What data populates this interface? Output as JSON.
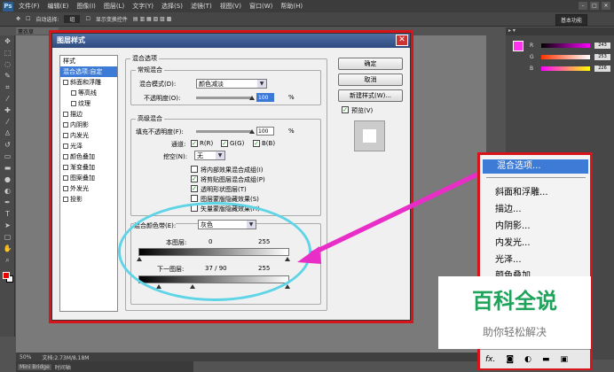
{
  "app": {
    "logo": "Ps",
    "menu": [
      "文件(F)",
      "编辑(E)",
      "图像(I)",
      "图层(L)",
      "文字(Y)",
      "选择(S)",
      "滤镜(T)",
      "视图(V)",
      "窗口(W)",
      "帮助(H)"
    ],
    "workspace": "基本功能"
  },
  "options": {
    "auto_select": "自动选择:",
    "auto_select_value": "组",
    "show_transform": "显示变换控件"
  },
  "doc_tab": "薰衣草",
  "status": {
    "zoom": "50%",
    "doc": "文档:2.73M/8.18M"
  },
  "bridge": {
    "tab1": "Mini Bridge",
    "tab2": "时间轴"
  },
  "color_panel": {
    "r": "243",
    "g": "253",
    "b": "226",
    "r_label": "R",
    "g_label": "G",
    "b_label": "B"
  },
  "dialog": {
    "title": "图层样式",
    "styles_header": "样式",
    "styles": [
      {
        "label": "混合选项:自定",
        "active": true,
        "checkbox": false,
        "indent": false
      },
      {
        "label": "斜面和浮雕",
        "checkbox": true,
        "indent": false
      },
      {
        "label": "等高线",
        "checkbox": true,
        "indent": true
      },
      {
        "label": "纹理",
        "checkbox": true,
        "indent": true
      },
      {
        "label": "描边",
        "checkbox": true,
        "indent": false
      },
      {
        "label": "内阴影",
        "checkbox": true,
        "indent": false
      },
      {
        "label": "内发光",
        "checkbox": true,
        "indent": false
      },
      {
        "label": "光泽",
        "checkbox": true,
        "indent": false
      },
      {
        "label": "颜色叠加",
        "checkbox": true,
        "indent": false
      },
      {
        "label": "渐变叠加",
        "checkbox": true,
        "indent": false
      },
      {
        "label": "图案叠加",
        "checkbox": true,
        "indent": false
      },
      {
        "label": "外发光",
        "checkbox": true,
        "indent": false
      },
      {
        "label": "投影",
        "checkbox": true,
        "indent": false
      }
    ],
    "blend_options": "混合选项",
    "general": "常规混合",
    "blend_mode_label": "混合模式(D):",
    "blend_mode_value": "颜色减淡",
    "opacity_label": "不透明度(O):",
    "opacity_value": "100",
    "percent": "%",
    "advanced": "高级混合",
    "fill_label": "填充不透明度(F):",
    "fill_value": "100",
    "channels_label": "通道:",
    "ch_r": "R(R)",
    "ch_g": "G(G)",
    "ch_b": "B(B)",
    "knockout_label": "挖空(N):",
    "knockout_value": "无",
    "options": [
      {
        "label": "将内部效果混合成组(I)",
        "checked": false
      },
      {
        "label": "将剪贴图层混合成组(P)",
        "checked": true
      },
      {
        "label": "透明形状图层(T)",
        "checked": true
      },
      {
        "label": "图层蒙版隐藏效果(S)",
        "checked": false
      },
      {
        "label": "矢量蒙版隐藏效果(H)",
        "checked": false
      }
    ],
    "blend_if_label": "混合颜色带(E):",
    "blend_if_value": "灰色",
    "this_layer": "本图层:",
    "this_min": "0",
    "this_max": "255",
    "under_layer": "下一图层:",
    "under_val": "37  /  90",
    "under_max": "255",
    "ok": "确定",
    "cancel": "取消",
    "new_style": "新建样式(W)...",
    "preview": "预览(V)"
  },
  "popup": {
    "items": [
      "混合选项...",
      "斜面和浮雕...",
      "描边...",
      "内阴影...",
      "内发光...",
      "光泽...",
      "颜色叠加..."
    ],
    "fx": "fx."
  },
  "watermark": {
    "title": "百科全说",
    "subtitle": "助你轻松解决"
  },
  "colors": {
    "accent": "#d8141a",
    "highlight": "#3d7bd6",
    "ellipse": "#5fd4e6",
    "arrow": "#e92ec8"
  }
}
